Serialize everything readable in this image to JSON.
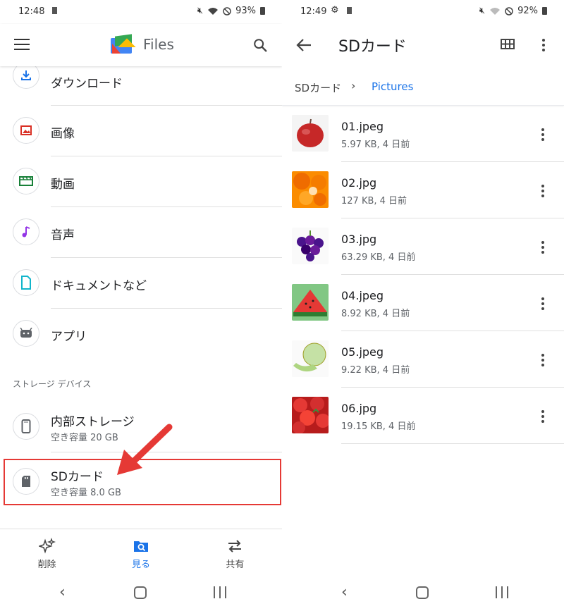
{
  "left": {
    "status": {
      "time": "12:48",
      "battery": "93%"
    },
    "header": {
      "title": "Files"
    },
    "categories": [
      {
        "label": "ダウンロード",
        "icon": "download-icon",
        "color": "#1a73e8"
      },
      {
        "label": "画像",
        "icon": "image-icon",
        "color": "#d93025"
      },
      {
        "label": "動画",
        "icon": "video-icon",
        "color": "#188038"
      },
      {
        "label": "音声",
        "icon": "audio-icon",
        "color": "#9334e6"
      },
      {
        "label": "ドキュメントなど",
        "icon": "document-icon",
        "color": "#12b5cb"
      },
      {
        "label": "アプリ",
        "icon": "android-icon",
        "color": "#5f6368"
      }
    ],
    "storage_header": "ストレージ デバイス",
    "storage": [
      {
        "title": "内部ストレージ",
        "sub": "空き容量 20 GB",
        "icon": "phone-icon"
      },
      {
        "title": "SDカード",
        "sub": "空き容量 8.0 GB",
        "icon": "sd-card-icon"
      }
    ],
    "bottom_nav": [
      {
        "label": "削除",
        "icon": "sparkle-icon"
      },
      {
        "label": "見る",
        "icon": "browse-icon"
      },
      {
        "label": "共有",
        "icon": "share-arrows-icon"
      }
    ]
  },
  "right": {
    "status": {
      "time": "12:49",
      "battery": "92%"
    },
    "header": {
      "title": "SDカード"
    },
    "breadcrumb": {
      "root": "SDカード",
      "current": "Pictures"
    },
    "files": [
      {
        "name": "01.jpeg",
        "meta": "5.97 KB, 4 日前",
        "thumb": "apple"
      },
      {
        "name": "02.jpg",
        "meta": "127 KB, 4 日前",
        "thumb": "orange"
      },
      {
        "name": "03.jpg",
        "meta": "63.29 KB, 4 日前",
        "thumb": "grape"
      },
      {
        "name": "04.jpeg",
        "meta": "8.92 KB, 4 日前",
        "thumb": "watermelon"
      },
      {
        "name": "05.jpeg",
        "meta": "9.22 KB, 4 日前",
        "thumb": "melon"
      },
      {
        "name": "06.jpg",
        "meta": "19.15 KB, 4 日前",
        "thumb": "strawberry"
      }
    ]
  },
  "colors": {
    "accent": "#1a73e8",
    "highlight": "#e53935"
  }
}
